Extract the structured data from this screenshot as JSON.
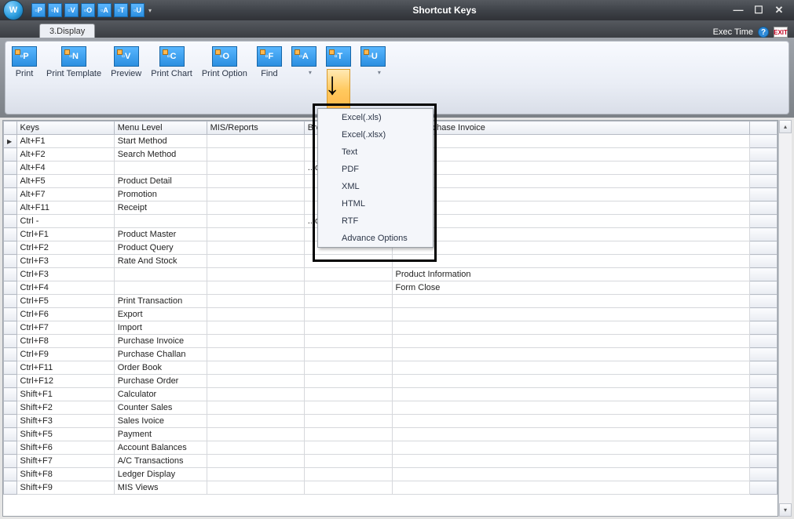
{
  "window": {
    "title": "Shortcut Keys",
    "orb_letter": "W",
    "qat": [
      "P",
      "N",
      "V",
      "O",
      "A",
      "T",
      "U"
    ],
    "exec_time_label": "Exec Time"
  },
  "tabs": {
    "active": "3.Display"
  },
  "ribbon": {
    "buttons": [
      {
        "code": "P",
        "label": "Print"
      },
      {
        "code": "N",
        "label": "Print Template"
      },
      {
        "code": "V",
        "label": "Preview"
      },
      {
        "code": "C",
        "label": "Print Chart"
      },
      {
        "code": "O",
        "label": "Print Option"
      },
      {
        "code": "F",
        "label": "Find"
      }
    ],
    "split_buttons": [
      "A",
      "T",
      "U"
    ]
  },
  "export_menu": {
    "items": [
      "Excel(.xls)",
      "Excel(.xlsx)",
      "Text",
      "PDF",
      "XML",
      "HTML",
      "RTF",
      "Advance Options"
    ]
  },
  "grid": {
    "columns": [
      "",
      "Keys",
      "Menu Level",
      "MIS/Reports",
      "Browse",
      "...tion/Purchase Invoice",
      ""
    ],
    "partial_col4_texts": {
      "3": "...ose",
      "7": "...ow"
    },
    "rows": [
      {
        "keys": "Alt+F1",
        "menu": "Start Method",
        "mis": "",
        "col4": "",
        "col5": ""
      },
      {
        "keys": "Alt+F2",
        "menu": "Search Method",
        "mis": "",
        "col4": "",
        "col5": ""
      },
      {
        "keys": "Alt+F4",
        "menu": "",
        "mis": "",
        "col4": "",
        "col5": ""
      },
      {
        "keys": "Alt+F5",
        "menu": "Product Detail",
        "mis": "",
        "col4": "",
        "col5": ""
      },
      {
        "keys": "Alt+F7",
        "menu": "Promotion",
        "mis": "",
        "col4": "",
        "col5": ""
      },
      {
        "keys": "Alt+F11",
        "menu": "Receipt",
        "mis": "",
        "col4": "",
        "col5": ""
      },
      {
        "keys": "Ctrl -",
        "menu": "",
        "mis": "",
        "col4": "",
        "col5": ""
      },
      {
        "keys": "Ctrl+F1",
        "menu": "Product Master",
        "mis": "",
        "col4": "",
        "col5": ""
      },
      {
        "keys": "Ctrl+F2",
        "menu": "Product Query",
        "mis": "",
        "col4": "",
        "col5": ""
      },
      {
        "keys": "Ctrl+F3",
        "menu": "Rate And Stock",
        "mis": "",
        "col4": "",
        "col5": ""
      },
      {
        "keys": "Ctrl+F3",
        "menu": "",
        "mis": "",
        "col4": "",
        "col5": "Product Information"
      },
      {
        "keys": "Ctrl+F4",
        "menu": "",
        "mis": "",
        "col4": "",
        "col5": "Form Close"
      },
      {
        "keys": "Ctrl+F5",
        "menu": "Print Transaction",
        "mis": "",
        "col4": "",
        "col5": ""
      },
      {
        "keys": "Ctrl+F6",
        "menu": "Export",
        "mis": "",
        "col4": "",
        "col5": ""
      },
      {
        "keys": "Ctrl+F7",
        "menu": "Import",
        "mis": "",
        "col4": "",
        "col5": ""
      },
      {
        "keys": "Ctrl+F8",
        "menu": "Purchase Invoice",
        "mis": "",
        "col4": "",
        "col5": ""
      },
      {
        "keys": "Ctrl+F9",
        "menu": "Purchase Challan",
        "mis": "",
        "col4": "",
        "col5": ""
      },
      {
        "keys": "Ctrl+F11",
        "menu": "Order Book",
        "mis": "",
        "col4": "",
        "col5": ""
      },
      {
        "keys": "Ctrl+F12",
        "menu": "Purchase Order",
        "mis": "",
        "col4": "",
        "col5": ""
      },
      {
        "keys": "Shift+F1",
        "menu": "Calculator",
        "mis": "",
        "col4": "",
        "col5": ""
      },
      {
        "keys": "Shift+F2",
        "menu": "Counter Sales",
        "mis": "",
        "col4": "",
        "col5": ""
      },
      {
        "keys": "Shift+F3",
        "menu": "Sales Ivoice",
        "mis": "",
        "col4": "",
        "col5": ""
      },
      {
        "keys": "Shift+F5",
        "menu": "Payment",
        "mis": "",
        "col4": "",
        "col5": ""
      },
      {
        "keys": "Shift+F6",
        "menu": "Account Balances",
        "mis": "",
        "col4": "",
        "col5": ""
      },
      {
        "keys": "Shift+F7",
        "menu": "A/C Transactions",
        "mis": "",
        "col4": "",
        "col5": ""
      },
      {
        "keys": "Shift+F8",
        "menu": "Ledger Display",
        "mis": "",
        "col4": "",
        "col5": ""
      },
      {
        "keys": "Shift+F9",
        "menu": "MIS Views",
        "mis": "",
        "col4": "",
        "col5": ""
      }
    ]
  }
}
